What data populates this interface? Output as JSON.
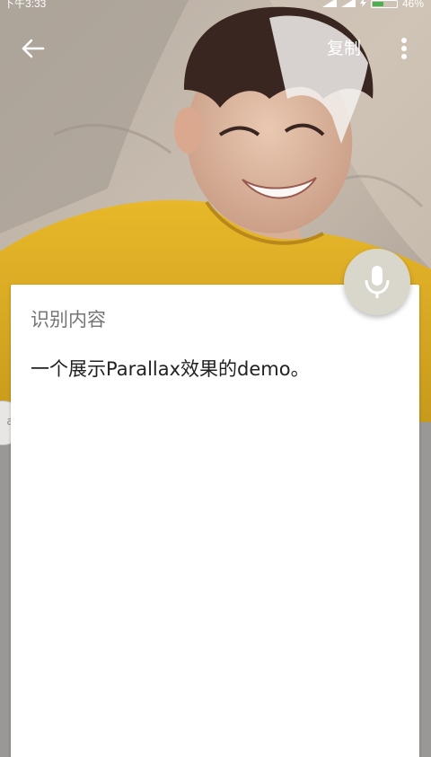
{
  "status_bar": {
    "time": "下午3:33",
    "battery": "46%",
    "icons": [
      "signal-icon",
      "signal-icon",
      "charging-icon",
      "battery-icon"
    ]
  },
  "toolbar": {
    "back_icon": "arrow-back-icon",
    "copy_label": "复制",
    "more_icon": "more-vertical-icon"
  },
  "card": {
    "title": "识别内容",
    "content": "一个展示Parallax效果的demo。"
  },
  "fab": {
    "icon": "microphone-icon"
  },
  "side_handle": {
    "label": "af"
  },
  "colors": {
    "toolbar_text": "#ffffff",
    "card_title": "#757575",
    "card_text": "#212121",
    "fab_background": "#d9d6cc",
    "shirt_yellow": "#e0b126"
  }
}
